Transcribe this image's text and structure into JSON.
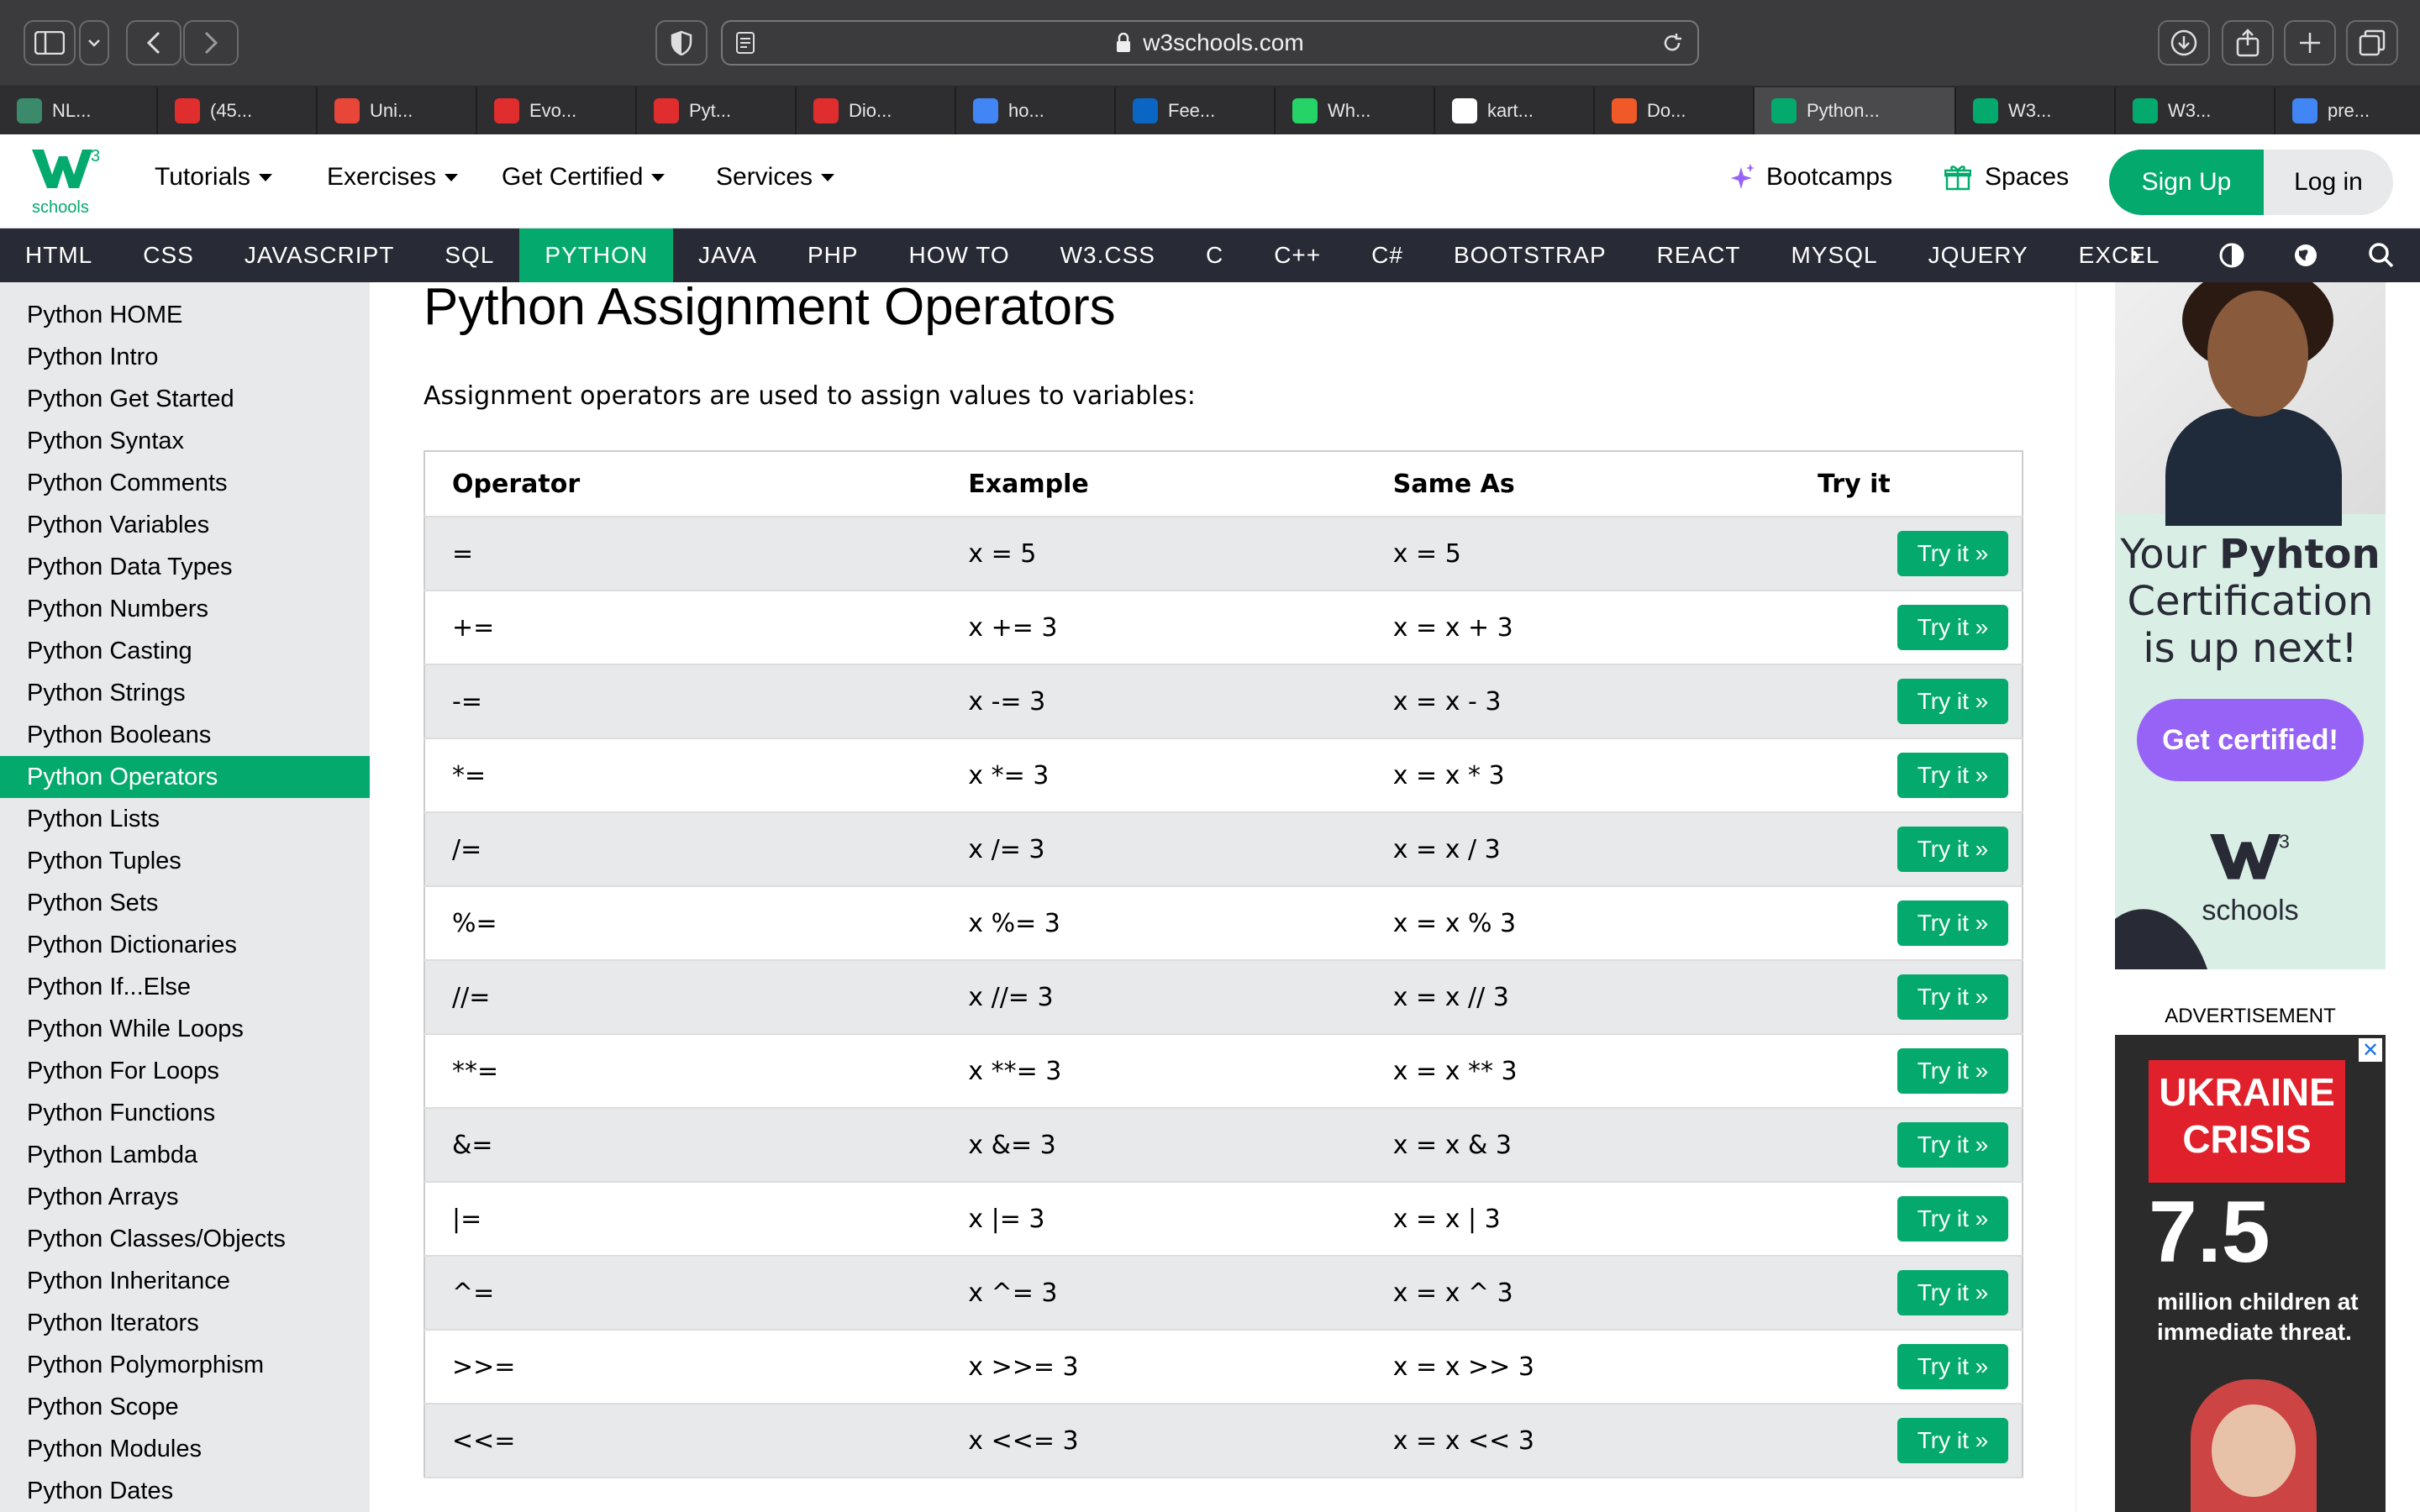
{
  "browser": {
    "url": "w3schools.com",
    "tabs": [
      {
        "label": "NL...",
        "color": "#3b8a6b"
      },
      {
        "label": "(45...",
        "color": "#e02d2d"
      },
      {
        "label": "Uni...",
        "color": "#e9463a"
      },
      {
        "label": "Evo...",
        "color": "#e02d2d"
      },
      {
        "label": "Pyt...",
        "color": "#e02d2d"
      },
      {
        "label": "Dio...",
        "color": "#e02d2d"
      },
      {
        "label": "ho...",
        "color": "#4285f4"
      },
      {
        "label": "Fee...",
        "color": "#0a66c2"
      },
      {
        "label": "Wh...",
        "color": "#25d366"
      },
      {
        "label": "kart...",
        "color": "#ffffff"
      },
      {
        "label": "Do...",
        "color": "#f05a28"
      },
      {
        "label": "Python...",
        "color": "#04aa6d"
      },
      {
        "label": "W3...",
        "color": "#04aa6d"
      },
      {
        "label": "W3...",
        "color": "#04aa6d"
      },
      {
        "label": "pre...",
        "color": "#4285f4"
      }
    ]
  },
  "topnav": {
    "logo_text": "schools",
    "logo_sup": "3",
    "items": [
      "Tutorials",
      "Exercises",
      "Get Certified",
      "Services"
    ],
    "bootcamps": "Bootcamps",
    "spaces": "Spaces",
    "signup": "Sign Up",
    "login": "Log in"
  },
  "subnav": [
    "HTML",
    "CSS",
    "JAVASCRIPT",
    "SQL",
    "PYTHON",
    "JAVA",
    "PHP",
    "HOW TO",
    "W3.CSS",
    "C",
    "C++",
    "C#",
    "BOOTSTRAP",
    "REACT",
    "MYSQL",
    "JQUERY",
    "EXCEL"
  ],
  "subnav_active": "PYTHON",
  "sidebar": {
    "items": [
      "Python HOME",
      "Python Intro",
      "Python Get Started",
      "Python Syntax",
      "Python Comments",
      "Python Variables",
      "Python Data Types",
      "Python Numbers",
      "Python Casting",
      "Python Strings",
      "Python Booleans",
      "Python Operators",
      "Python Lists",
      "Python Tuples",
      "Python Sets",
      "Python Dictionaries",
      "Python If...Else",
      "Python While Loops",
      "Python For Loops",
      "Python Functions",
      "Python Lambda",
      "Python Arrays",
      "Python Classes/Objects",
      "Python Inheritance",
      "Python Iterators",
      "Python Polymorphism",
      "Python Scope",
      "Python Modules",
      "Python Dates"
    ],
    "active": "Python Operators"
  },
  "main": {
    "title": "Python Assignment Operators",
    "intro": "Assignment operators are used to assign values to variables:",
    "headers": [
      "Operator",
      "Example",
      "Same As",
      "Try it"
    ],
    "try_label": "Try it »",
    "rows": [
      [
        "=",
        "x = 5",
        "x = 5"
      ],
      [
        "+=",
        "x += 3",
        "x = x + 3"
      ],
      [
        "-=",
        "x -= 3",
        "x = x - 3"
      ],
      [
        "*=",
        "x *= 3",
        "x = x * 3"
      ],
      [
        "/=",
        "x /= 3",
        "x = x / 3"
      ],
      [
        "%=",
        "x %= 3",
        "x = x % 3"
      ],
      [
        "//=",
        "x //= 3",
        "x = x // 3"
      ],
      [
        "**=",
        "x **= 3",
        "x = x ** 3"
      ],
      [
        "&=",
        "x &= 3",
        "x = x & 3"
      ],
      [
        "|=",
        "x |= 3",
        "x = x | 3"
      ],
      [
        "^=",
        "x ^= 3",
        "x = x ^ 3"
      ],
      [
        ">>=",
        "x >>= 3",
        "x = x >> 3"
      ],
      [
        "<<=",
        "x <<= 3",
        "x = x << 3"
      ]
    ]
  },
  "ads": {
    "ad1_line1": "Your",
    "ad1_brand": "Pyhton",
    "ad1_line2": "Certification",
    "ad1_line3": "is up next!",
    "ad1_button": "Get certified!",
    "ad1_logo": "schools",
    "label": "ADVERTISEMENT",
    "ad2_title1": "UKRAINE",
    "ad2_title2": "CRISIS",
    "ad2_big": "7.5",
    "ad2_sub": "million children at immediate threat."
  }
}
